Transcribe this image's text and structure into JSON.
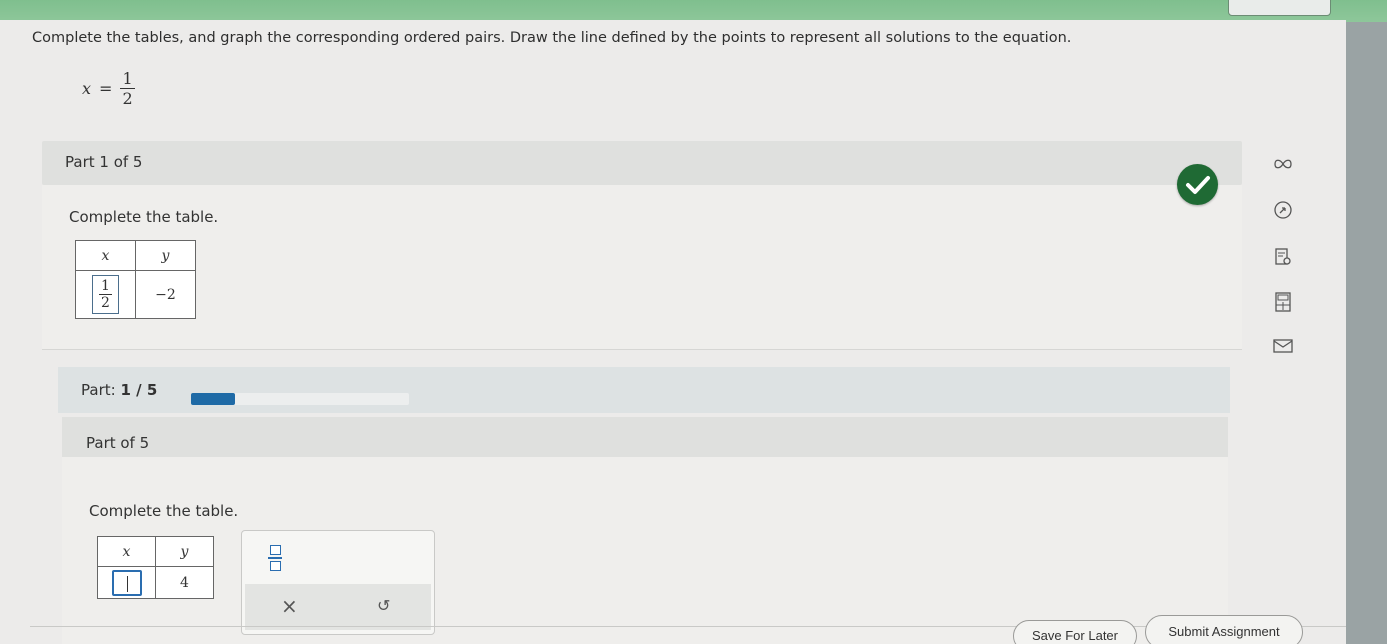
{
  "instructions": "Complete the tables, and graph the corresponding ordered pairs. Draw the line defined by the points to represent all solutions to the equation.",
  "equation": {
    "lhs": "x",
    "eq": "=",
    "numerator": "1",
    "denominator": "2"
  },
  "part1": {
    "title": "Part 1 of 5",
    "prompt": "Complete the table.",
    "table": {
      "header_x": "x",
      "header_y": "y",
      "x_numerator": "1",
      "x_denominator": "2",
      "y_value": "−2"
    }
  },
  "progress": {
    "label": "Part:",
    "value": "1 / 5",
    "fraction": 0.2
  },
  "part2": {
    "title": "Part  of 5",
    "prompt": "Complete the table.",
    "table": {
      "header_x": "x",
      "header_y": "y",
      "y_value": "4"
    }
  },
  "keypad": {
    "clear": "×",
    "undo": "↺"
  },
  "buttons": {
    "save_later": "Save For Later",
    "submit": "Submit Assignment"
  },
  "icons": [
    "infinity-icon",
    "compass-icon",
    "search-doc-icon",
    "calculator-icon",
    "mail-icon",
    "checkmark-icon"
  ],
  "colors": {
    "check": "#1f6a34",
    "progress": "#1e6aa6",
    "header_green": "#8ec79a"
  }
}
